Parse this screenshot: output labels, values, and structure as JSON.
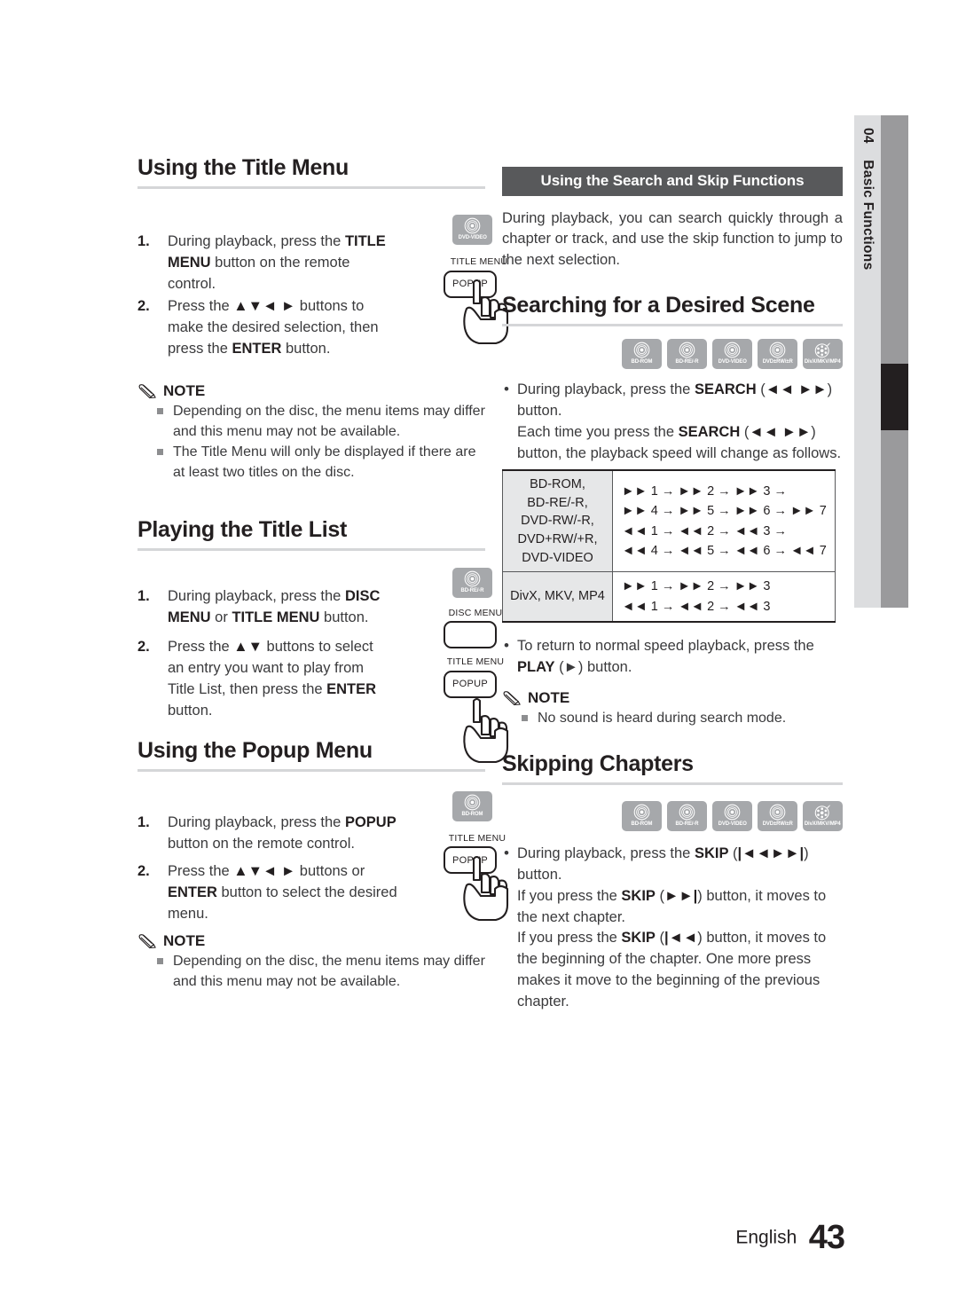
{
  "sidetab": {
    "chapter_number": "04",
    "chapter_name": "Basic Functions"
  },
  "left_column": {
    "title_menu_section": {
      "heading": "Using the Title Menu",
      "badge": {
        "label": "DVD-VIDEO",
        "icon": "disc-icon"
      },
      "remote": {
        "caption_top": "TITLE MENU",
        "key_label": "POPUP",
        "icon": "hand-pressing-button-icon"
      },
      "steps": [
        {
          "num": "1.",
          "html": "During playback, press the <b>TITLE MENU</b> button on the remote control."
        },
        {
          "num": "2.",
          "html": "Press the <b>▲▼◄ ►</b> buttons to make the desired selection, then press the <b>ENTER</b> button."
        }
      ],
      "note": {
        "label": "NOTE",
        "items": [
          "Depending on the disc, the menu items may differ and this menu may not be available.",
          "The Title Menu will only be displayed if there are at least two titles on the disc."
        ]
      }
    },
    "title_list_section": {
      "heading": "Playing the Title List",
      "badge": {
        "label": "BD-RE/-R",
        "icon": "disc-icon"
      },
      "remote": {
        "caption_1": "DISC MENU",
        "caption_2": "TITLE MENU",
        "key_label": "POPUP",
        "icon": "hand-pressing-button-icon"
      },
      "steps": [
        {
          "num": "1.",
          "html": "During playback, press the <b>DISC MENU</b> or <b>TITLE MENU</b> button."
        },
        {
          "num": "2.",
          "html": "Press the <b>▲▼</b> buttons to select an entry you want to play from Title List, then press the <b>ENTER</b> button."
        }
      ]
    },
    "popup_menu_section": {
      "heading": "Using the Popup Menu",
      "badge": {
        "label": "BD-ROM",
        "icon": "disc-icon"
      },
      "remote": {
        "caption_top": "TITLE MENU",
        "key_label": "POPUP",
        "icon": "hand-pressing-button-icon"
      },
      "steps": [
        {
          "num": "1.",
          "html": "During playback, press the <b>POPUP</b> button on the remote control."
        },
        {
          "num": "2.",
          "html": "Press the <b>▲▼◄ ►</b> buttons or <b>ENTER</b> button to select the desired menu."
        }
      ],
      "note": {
        "label": "NOTE",
        "items": [
          "Depending on the disc, the menu items may differ and this menu may not be available."
        ]
      }
    }
  },
  "right_column": {
    "banner": "Using the Search and Skip Functions",
    "intro": "During playback, you can search quickly through a chapter or track, and use the skip function to jump to the next selection.",
    "search_section": {
      "heading": "Searching for a Desired Scene",
      "badges": [
        {
          "label": "BD-ROM",
          "icon": "disc-icon"
        },
        {
          "label": "BD-RE/-R",
          "icon": "disc-icon"
        },
        {
          "label": "DVD-VIDEO",
          "icon": "disc-icon"
        },
        {
          "label": "DVD±RW/±R",
          "icon": "disc-icon"
        },
        {
          "label": "DivX/MKV/MP4",
          "icon": "film-reel-icon"
        }
      ],
      "bullet_html": "During playback, press the <b>SEARCH</b> (<b>◄◄ ►►</b>) button.<br>Each time you press the <b>SEARCH</b> (<b>◄◄ ►►</b>) button, the playback speed will change as follows.",
      "table": {
        "rows": [
          {
            "formats": [
              "BD-ROM,",
              "BD-RE/-R,",
              "DVD-RW/-R,",
              "DVD+RW/+R,",
              "DVD-VIDEO"
            ],
            "sequences": [
              "►► 1 → ►► 2 → ►► 3 →",
              "►► 4 → ►► 5 → ►► 6 → ►► 7",
              "◄◄ 1 → ◄◄ 2 → ◄◄ 3 →",
              "◄◄ 4 → ◄◄ 5 → ◄◄ 6 → ◄◄ 7"
            ]
          },
          {
            "formats": [
              "DivX, MKV, MP4"
            ],
            "sequences": [
              "►► 1 → ►► 2 → ►► 3",
              "◄◄ 1 → ◄◄ 2 → ◄◄ 3"
            ]
          }
        ]
      },
      "bullet_return_html": "To return to normal speed playback, press the <b>PLAY</b> (►) button.",
      "note": {
        "label": "NOTE",
        "items": [
          "No sound is heard during search mode."
        ]
      }
    },
    "skip_section": {
      "heading": "Skipping Chapters",
      "badges": [
        {
          "label": "BD-ROM",
          "icon": "disc-icon"
        },
        {
          "label": "BD-RE/-R",
          "icon": "disc-icon"
        },
        {
          "label": "DVD-VIDEO",
          "icon": "disc-icon"
        },
        {
          "label": "DVD±RW/±R",
          "icon": "disc-icon"
        },
        {
          "label": "DivX/MKV/MP4",
          "icon": "film-reel-icon"
        }
      ],
      "bullet_html": "During playback, press the <b>SKIP</b> (<b>|◄◄►►|</b>) button.<br>If you press the <b>SKIP</b> (<b>►►|</b>) button, it moves to the next chapter.<br>If you press the <b>SKIP</b> (<b>|◄◄</b>) button, it moves to the beginning of the chapter. One more press makes it move to the beginning of the previous chapter."
    }
  },
  "footer": {
    "language": "English",
    "page_number": "43"
  }
}
